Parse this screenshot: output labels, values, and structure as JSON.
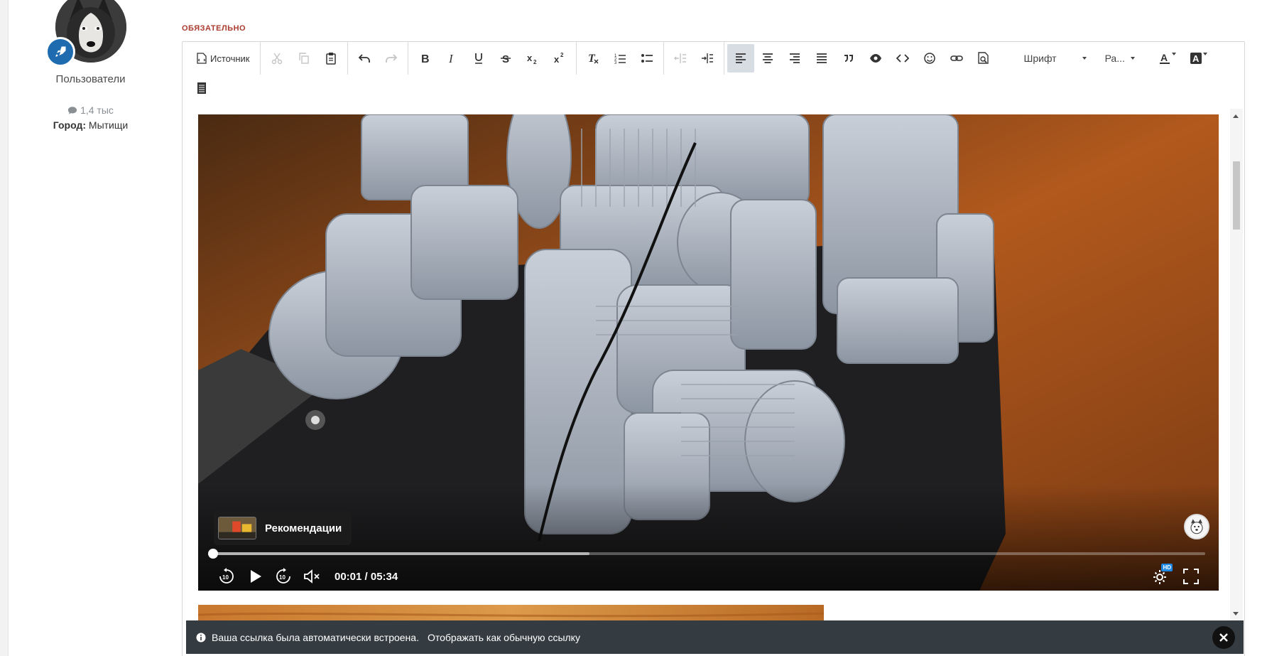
{
  "profile": {
    "group_name": "Пользователи",
    "post_count": "1,4 тыс",
    "city_label": "Город:",
    "city_value": "Мытищи"
  },
  "editor": {
    "required_label": "ОБЯЗАТЕЛЬНО",
    "toolbar": {
      "source_label": "Источник",
      "font_combo": "Шрифт",
      "size_combo": "Ра..."
    }
  },
  "video": {
    "recommendations_label": "Рекомендации",
    "current_time": "00:01",
    "duration": "05:34",
    "time_display": "00:01 / 05:34",
    "buffered_fraction": 0.38,
    "played_fraction": 0.0,
    "hd_badge": "HD"
  },
  "notice": {
    "message": "Ваша ссылка была автоматически встроена.",
    "link_label": "Отображать как обычную ссылку"
  },
  "colors": {
    "accent": "#1f6bb0",
    "required": "#aa3b2e",
    "notice_bg": "#353c41",
    "hd_blue": "#1e88e5"
  }
}
